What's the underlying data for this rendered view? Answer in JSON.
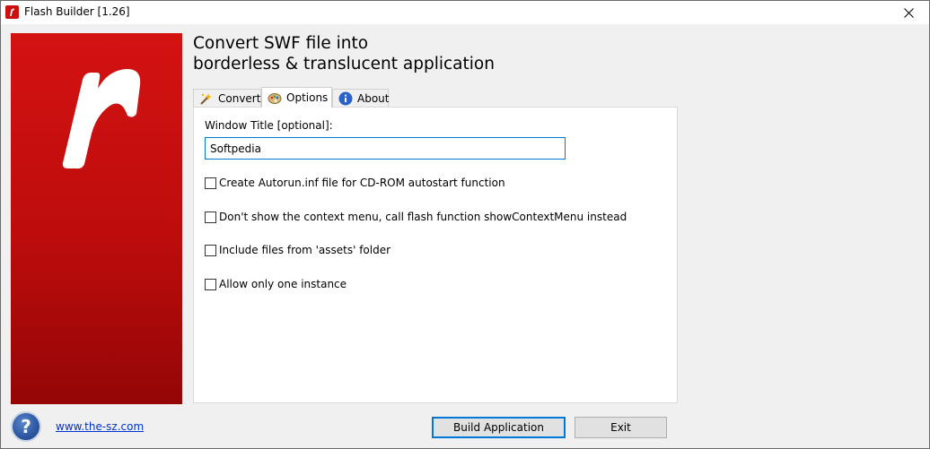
{
  "window": {
    "title": "Flash Builder [1.26]"
  },
  "header": {
    "line1": "Convert SWF file into",
    "line2": "borderless & translucent application"
  },
  "tabs": [
    {
      "label": "Convert",
      "icon": "wand-icon",
      "active": false
    },
    {
      "label": "Options",
      "icon": "palette-icon",
      "active": true
    },
    {
      "label": "About",
      "icon": "info-icon",
      "active": false
    }
  ],
  "options": {
    "window_title_label": "Window Title [optional]:",
    "window_title_value": "Softpedia",
    "checkboxes": [
      {
        "label": "Create Autorun.inf file for CD-ROM autostart function",
        "checked": false
      },
      {
        "label": "Don't show the context menu, call flash function showContextMenu instead",
        "checked": false
      },
      {
        "label": "Include files from 'assets' folder",
        "checked": false
      },
      {
        "label": "Allow only one instance",
        "checked": false
      }
    ]
  },
  "footer": {
    "link": "www.the-sz.com",
    "build_button": "Build Application",
    "exit_button": "Exit"
  },
  "colors": {
    "brand_red": "#cc1010",
    "focus_blue": "#0078d7",
    "link_blue": "#0033cc"
  }
}
